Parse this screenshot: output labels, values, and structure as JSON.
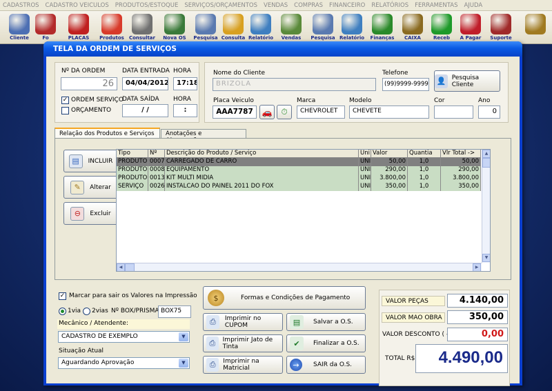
{
  "menu": [
    "CADASTROS",
    "CADASTRO VEICULOS",
    "PRODUTOS/ESTOQUE",
    "SERVIÇOS/ORÇAMENTOS",
    "VENDAS",
    "COMPRAS",
    "FINANCEIRO",
    "RELATÓRIOS",
    "FERRAMENTAS",
    "AJUDA"
  ],
  "toolbar": [
    {
      "label": "Cliente",
      "icon": "client-icon",
      "color": "#4d6fb3"
    },
    {
      "label": "Fo",
      "icon": "supplier-icon",
      "color": "#b32a2a"
    },
    {
      "label": "PLACAS",
      "icon": "car-icon",
      "color": "#c02020"
    },
    {
      "label": "Produtos",
      "icon": "products-icon",
      "color": "#d83a2a"
    },
    {
      "label": "Consultar",
      "icon": "barcode-icon",
      "color": "#707070"
    },
    {
      "label": "Nova OS",
      "icon": "new-order-icon",
      "color": "#3a7a3a"
    },
    {
      "label": "Pesquisa",
      "icon": "search-doc-icon",
      "color": "#5a7ab0"
    },
    {
      "label": "Consulta",
      "icon": "folder-icon",
      "color": "#d8a020"
    },
    {
      "label": "Relatório",
      "icon": "report-icon",
      "color": "#3f7fc0"
    },
    {
      "label": "Vendas",
      "icon": "cart-icon",
      "color": "#5a8a3a"
    },
    {
      "label": "Pesquisa",
      "icon": "search-doc-icon",
      "color": "#5a7ab0"
    },
    {
      "label": "Relatório",
      "icon": "report-icon",
      "color": "#3f7fc0"
    },
    {
      "label": "Finanças",
      "icon": "finance-icon",
      "color": "#2a8a2a"
    },
    {
      "label": "CAIXA",
      "icon": "cashbox-icon",
      "color": "#8a6a20"
    },
    {
      "label": "Receb",
      "icon": "dollar-green-icon",
      "color": "#1e9a2a"
    },
    {
      "label": "A Pagar",
      "icon": "dollar-red-icon",
      "color": "#c01e2a"
    },
    {
      "label": "Suporte",
      "icon": "support-icon",
      "color": "#a02a2a"
    },
    {
      "label": "",
      "icon": "exit-icon",
      "color": "#a07a20"
    }
  ],
  "window": {
    "title": "TELA DA ORDEM DE SERVIÇOS"
  },
  "order": {
    "number_label": "Nº DA ORDEM",
    "number": "26",
    "entry_label": "DATA ENTRADA",
    "entry_date": "04/04/2012",
    "time_label": "HORA",
    "entry_time": "17:18",
    "exit_label": "DATA SAÍDA",
    "exit_date": " / /",
    "exit_time_label": "HORA",
    "exit_time": ":",
    "type_service": "ORDEM SERVIÇO",
    "type_quote": "ORÇAMENTO"
  },
  "client": {
    "name_label": "Nome do Cliente",
    "name": "BRIZOLA",
    "phone_label": "Telefone",
    "phone": "(99)9999-9999",
    "search_button": "Pesquisa Cliente",
    "plate_label": "Placa Veiculo",
    "plate": "AAA7787",
    "brand_label": "Marca",
    "brand": "CHEVROLET",
    "model_label": "Modelo",
    "model": "CHEVETE",
    "color_label": "Cor",
    "color": "",
    "year_label": "Ano",
    "year": "0"
  },
  "tabs": [
    "Relação dos Produtos e Serviços ->",
    "Anotações e Observações ->"
  ],
  "side_buttons": {
    "add": "INCLUIR",
    "edit": "Alterar",
    "delete": "Excluir"
  },
  "table": {
    "headers": [
      "Tipo",
      "Nº",
      "Descrição do Produto / Serviço",
      "Uni",
      "Valor",
      "Quantia",
      "Vlr Total ->"
    ],
    "rows": [
      [
        "PRODUTO",
        "0007",
        "CARREGADO DE CARRO",
        "UNI",
        "50,00",
        "1,0",
        "50,00"
      ],
      [
        "PRODUTO",
        "0008",
        "EQUIPAMENTO",
        "UNI",
        "290,00",
        "1,0",
        "290,00"
      ],
      [
        "PRODUTO",
        "0013",
        "KIT MULTI MIDIA",
        "UNI",
        "3.800,00",
        "1,0",
        "3.800,00"
      ],
      [
        "SERVIÇO",
        "0026",
        "INSTALCAO DO PAINEL 2011 DO FOX",
        "UNI",
        "350,00",
        "1,0",
        "350,00"
      ]
    ]
  },
  "print_opts": {
    "show_values": "Marcar para sair os Valores na Impressão",
    "one_copy": "1via",
    "two_copies": "2vias",
    "box_label": "Nº BOX/PRISMA",
    "box": "BOX75",
    "mechanic_label": "Mecânico / Atendente:",
    "mechanic": "CADASTRO DE EXEMPLO",
    "status_label": "Situação Atual",
    "status": "Aguardando Aprovação"
  },
  "actions": {
    "payment": "Formas e Condições de Pagamento",
    "print_coupon": "Imprimir no CUPOM",
    "save": "Salvar a O.S.",
    "print_inkjet": "Imprimir Jato de Tinta",
    "finalize": "Finalizar a O.S.",
    "print_dot": "Imprimir na Matricial",
    "exit": "SAIR da O.S."
  },
  "totals": {
    "parts_label": "VALOR PEÇAS",
    "parts": "4.140,00",
    "labor_label": "VALOR MAO OBRA",
    "labor": "350,00",
    "discount_label": "VALOR DESCONTO ( - )",
    "discount": "0,00",
    "total_label": "TOTAL R$",
    "total": "4.490,00"
  }
}
